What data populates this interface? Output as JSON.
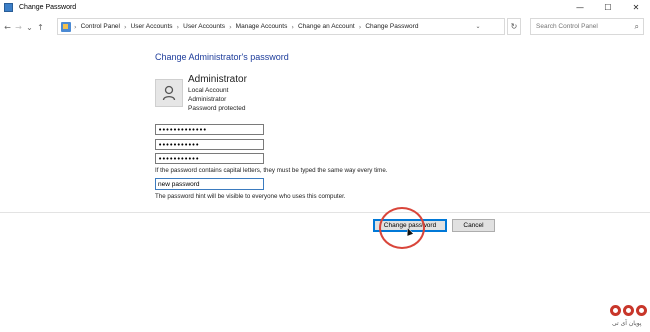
{
  "window": {
    "title": "Change Password",
    "controls": {
      "minimize": "—",
      "maximize": "☐",
      "close": "✕"
    }
  },
  "nav": {
    "back": "←",
    "forward": "→",
    "recent": "⌄",
    "up": "↑",
    "breadcrumbs": [
      "Control Panel",
      "User Accounts",
      "User Accounts",
      "Manage Accounts",
      "Change an Account",
      "Change Password"
    ],
    "separator": "›",
    "dropdown": "⌄",
    "refresh": "↻",
    "search_placeholder": "Search Control Panel",
    "search_glyph": "⌕"
  },
  "content": {
    "heading": "Change Administrator's password",
    "account": {
      "name": "Administrator",
      "details": [
        "Local Account",
        "Administrator",
        "Password protected"
      ]
    },
    "fields": {
      "current_password": "•••••••••••••",
      "new_password": "•••••••••••",
      "confirm_password": "•••••••••••",
      "caps_note": "If the password contains capital letters, they must be typed the same way every time.",
      "hint_value": "new password",
      "hint_note": "The password hint will be visible to everyone who uses this computer."
    },
    "buttons": {
      "change": "Change password",
      "cancel": "Cancel"
    }
  },
  "watermark": {
    "text": "پویان آی تی"
  },
  "colors": {
    "heading": "#1e3d9b",
    "focus": "#0078d7",
    "annotation": "#d9453a"
  }
}
